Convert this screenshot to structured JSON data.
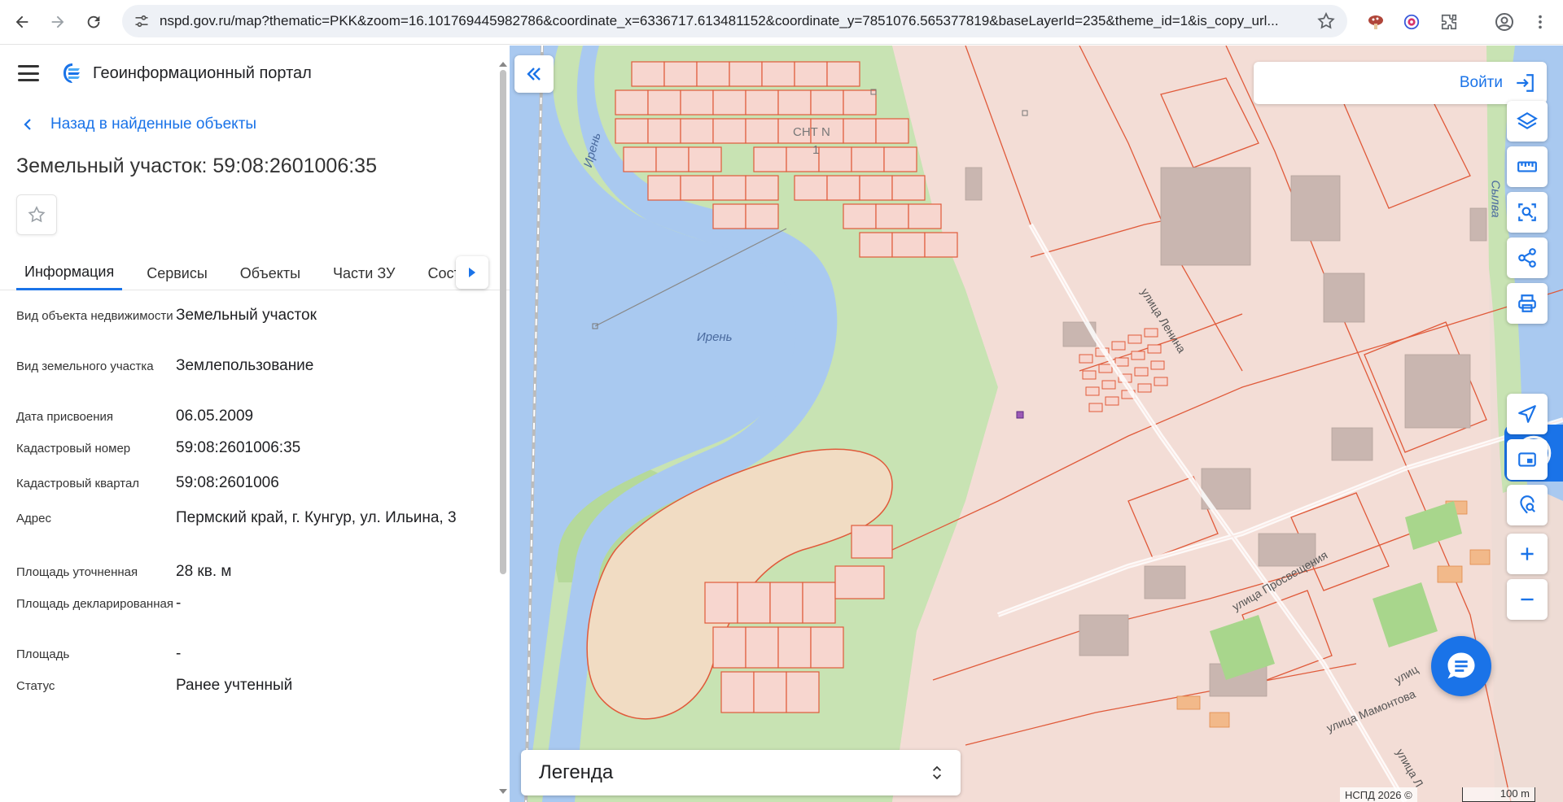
{
  "browser": {
    "url": "nspd.gov.ru/map?thematic=PKK&zoom=16.101769445982786&coordinate_x=6336717.613481152&coordinate_y=7851076.565377819&baseLayerId=235&theme_id=1&is_copy_url..."
  },
  "panel": {
    "portal_title": "Геоинформационный портал",
    "back_link": "Назад в найденные объекты",
    "object_title": "Земельный участок: 59:08:2601006:35",
    "tabs": [
      {
        "label": "Информация",
        "active": true
      },
      {
        "label": "Сервисы",
        "active": false
      },
      {
        "label": "Объекты",
        "active": false
      },
      {
        "label": "Части ЗУ",
        "active": false
      },
      {
        "label": "Соста",
        "active": false
      }
    ],
    "rows": [
      {
        "label": "Вид объекта недвижимости",
        "value": "Земельный участок"
      },
      {
        "label": "Вид земельного участка",
        "value": "Землепользование"
      },
      {
        "label": "Дата присвоения",
        "value": "06.05.2009"
      },
      {
        "label": "Кадастровый номер",
        "value": "59:08:2601006:35"
      },
      {
        "label": "Кадастровый квартал",
        "value": "59:08:2601006"
      },
      {
        "label": "Адрес",
        "value": "Пермский край, г. Кунгур, ул. Ильина, 3"
      },
      {
        "label": "Площадь уточненная",
        "value": "28 кв. м"
      },
      {
        "label": "Площадь декларированная",
        "value": "-"
      },
      {
        "label": "Площадь",
        "value": "-"
      },
      {
        "label": "Статус",
        "value": "Ранее учтенный"
      }
    ]
  },
  "map": {
    "login_label": "Войти",
    "legend_label": "Легенда",
    "attribution": "НСПД 2026 ©",
    "scale_label": "100 m",
    "labels": [
      {
        "text": "Ирень"
      },
      {
        "text": "Ирень"
      },
      {
        "text": "СНТ N"
      },
      {
        "text": "1"
      },
      {
        "text": "Сылва"
      },
      {
        "text": "улица Ленина"
      },
      {
        "text": "улица Просвещения"
      },
      {
        "text": "улица Мамонтова"
      },
      {
        "text": "улиц"
      },
      {
        "text": "улица Л"
      }
    ],
    "tools": [
      "layers-icon",
      "ruler-icon",
      "select-area-icon",
      "share-icon",
      "print-icon",
      "navigate-icon",
      "minimap-icon",
      "location-search-icon",
      "zoom-in-icon",
      "zoom-out-icon"
    ]
  }
}
